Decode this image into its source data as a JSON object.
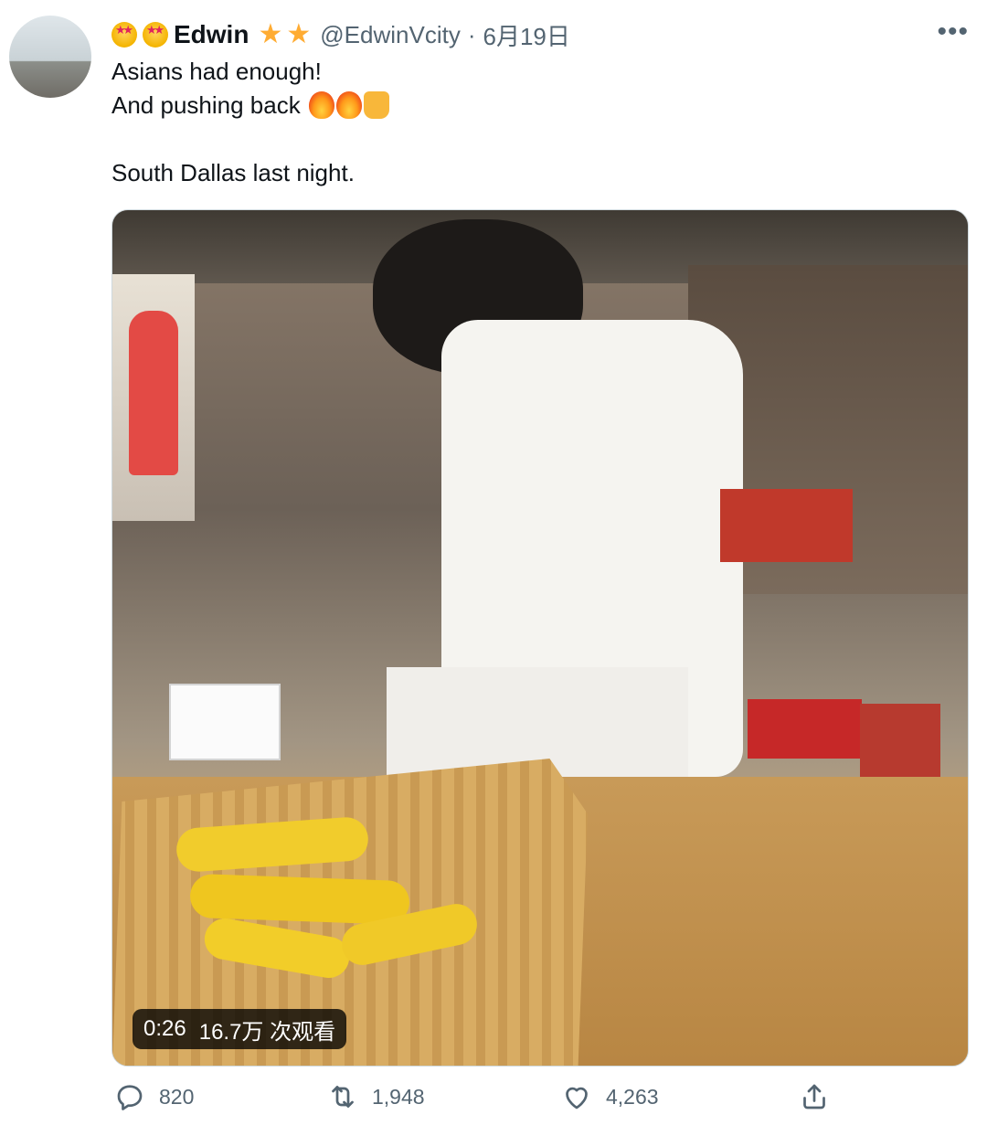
{
  "author": {
    "display_name": "Edwin",
    "handle": "@EdwinVcity",
    "separator": "·",
    "date": "6月19日"
  },
  "tweet": {
    "line1": "Asians had enough!",
    "line2": "And pushing back",
    "line3": "South Dallas last night."
  },
  "video": {
    "duration": "0:26",
    "views": "16.7万 次观看"
  },
  "actions": {
    "reply_count": "820",
    "retweet_count": "1,948",
    "like_count": "4,263"
  },
  "icons": {
    "header_left": [
      "star-struck-emoji",
      "star-struck-emoji"
    ],
    "header_right": [
      "glowing-star-emoji",
      "glowing-star-emoji"
    ],
    "text": [
      "fire-emoji",
      "fire-emoji",
      "oncoming-fist-emoji"
    ],
    "actions": [
      "reply-icon",
      "retweet-icon",
      "like-icon",
      "share-icon"
    ]
  },
  "colors": {
    "text_primary": "#0f1419",
    "text_secondary": "#536471",
    "border": "#cfd9de"
  }
}
